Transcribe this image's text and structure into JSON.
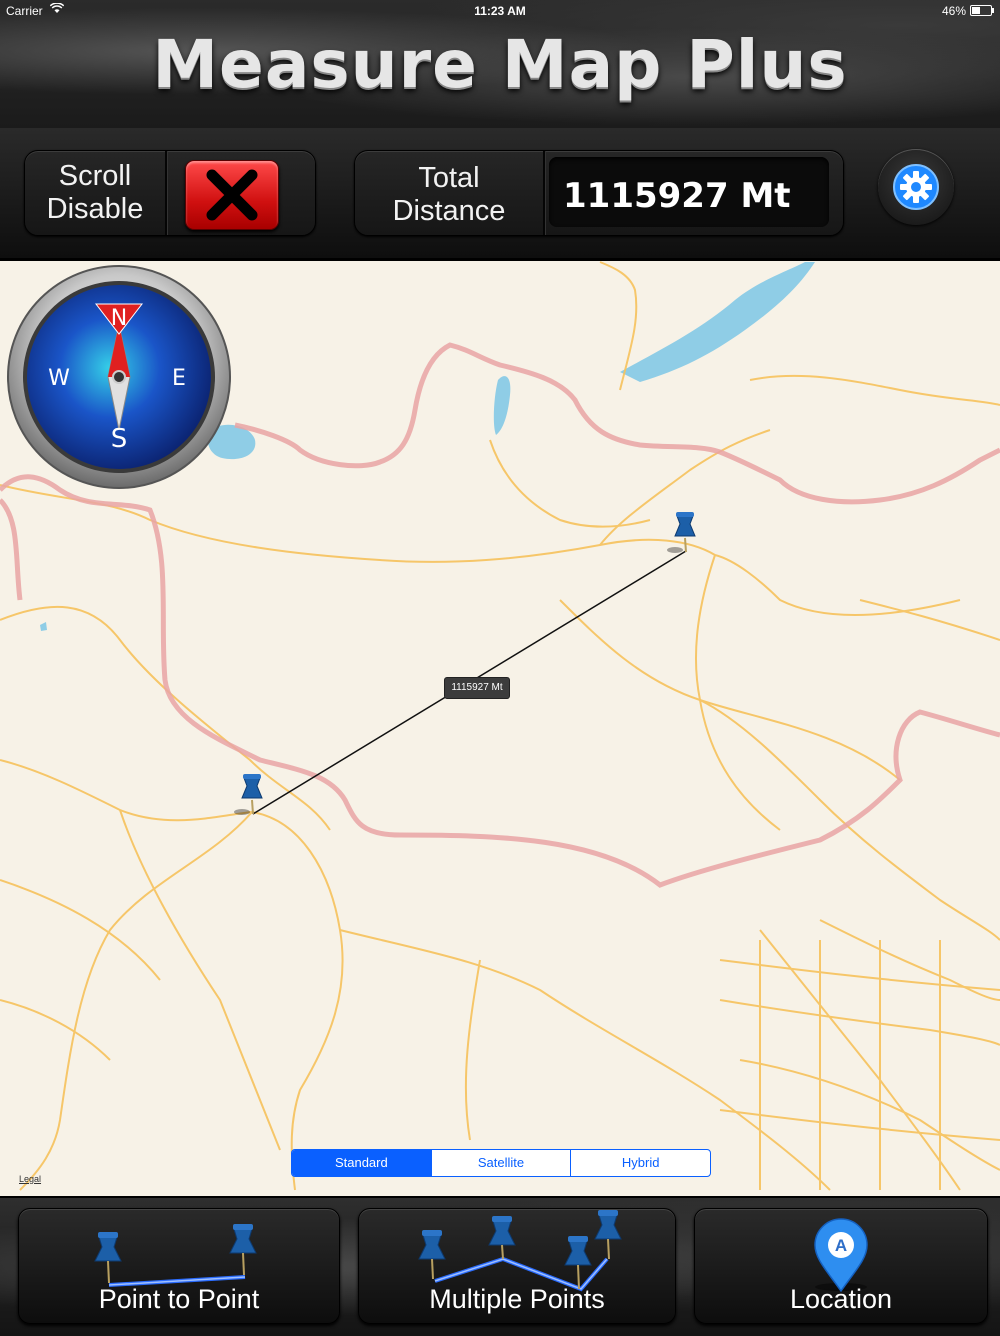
{
  "status_bar": {
    "carrier": "Carrier",
    "time": "11:23 AM",
    "battery": "46%",
    "battery_level": 0.46
  },
  "header": {
    "title": "Measure Map Plus"
  },
  "toolbar": {
    "scroll_label": "Scroll Disable",
    "total_label": "Total Distance",
    "total_value": "1115927 Mt"
  },
  "map": {
    "distance_tag": "1115927 Mt",
    "legal": "Legal",
    "map_types": [
      "Standard",
      "Satellite",
      "Hybrid"
    ],
    "selected_map_type": "Standard",
    "compass": {
      "n": "N",
      "e": "E",
      "s": "S",
      "w": "W"
    }
  },
  "bottom_bar": {
    "point_to_point": "Point to Point",
    "multiple_points": "Multiple Points",
    "location": "Location",
    "location_pin_letter": "A"
  },
  "colors": {
    "accent_blue": "#0a60ff",
    "x_button_red": "#d01010",
    "pin_blue": "#1c5fa8",
    "road_orange": "#f6c25c",
    "border_pink": "#e9a5a5",
    "water_blue": "#8fcde6"
  }
}
